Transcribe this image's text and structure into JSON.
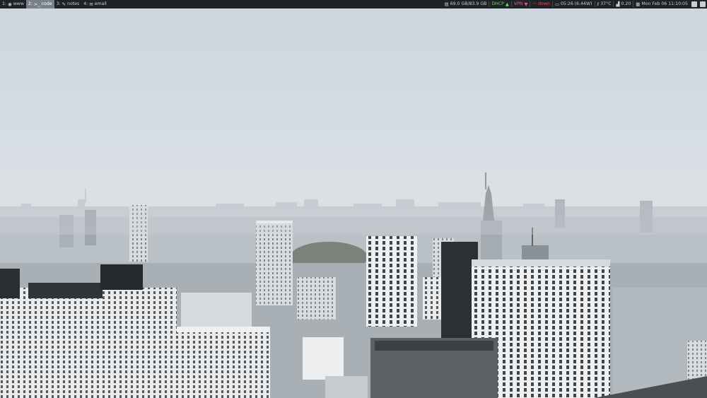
{
  "workspaces": [
    {
      "num": "1:",
      "icon": "globe-icon",
      "label": "www",
      "active": false
    },
    {
      "num": "2:",
      "icon": "terminal-icon",
      "label": "code",
      "active": true
    },
    {
      "num": "3:",
      "icon": "edit-icon",
      "label": "notes",
      "active": false
    },
    {
      "num": "4:",
      "icon": "envelope-icon",
      "label": "email",
      "active": false
    }
  ],
  "status": {
    "disk": "69.0 GB/83.9 GB",
    "dhcp": "DHCP",
    "vpn": "VPN",
    "wifi": "down",
    "battery": "05:26 (6.44W)",
    "temperature": "37°C",
    "load": "0.20",
    "datetime": "Mon Feb 06  11:10:05"
  },
  "colors": {
    "bar_bg": "#1f2326",
    "active_ws": "#7a8088",
    "ok": "#6bd36b",
    "vpn": "#e9578f",
    "down": "#e05757"
  }
}
